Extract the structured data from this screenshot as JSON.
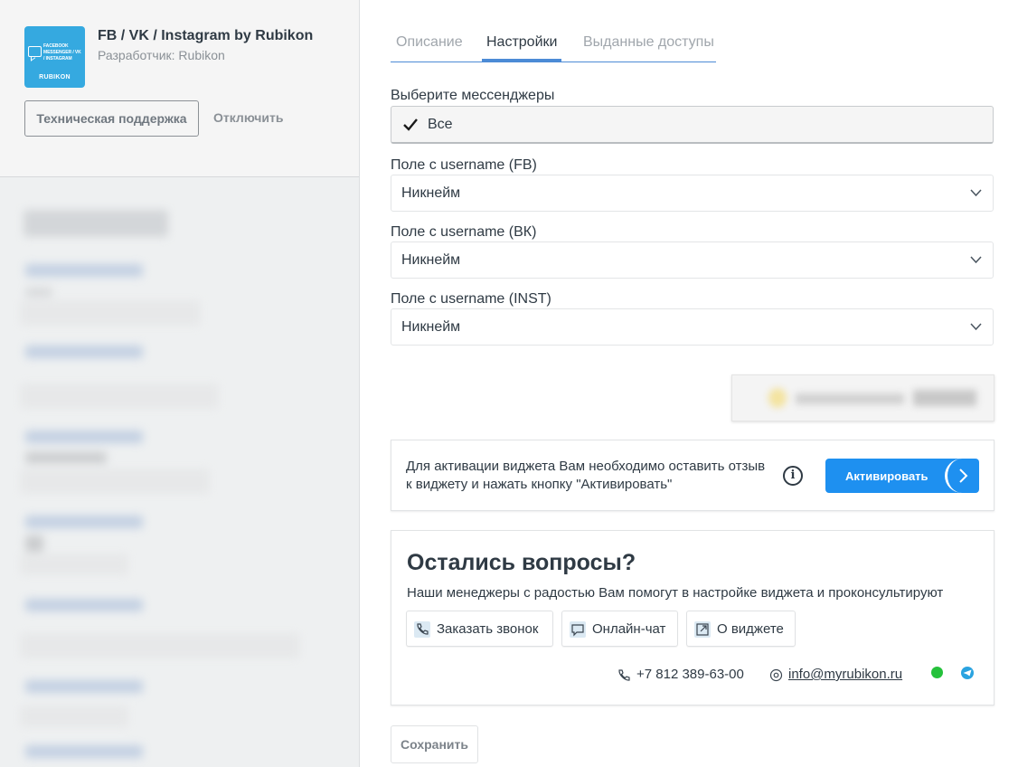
{
  "app": {
    "title": "FB / VK / Instagram by Rubikon",
    "developer": "Разработчик: Rubikon",
    "logo_text": "FACEBOOK MESSENGER / VK / INSTAGRAM",
    "logo_brand": "RUBIKON",
    "support_label": "Техническая поддержка",
    "disable_label": "Отключить"
  },
  "tabs": [
    {
      "label": "Описание",
      "active": false
    },
    {
      "label": "Настройки",
      "active": true
    },
    {
      "label": "Выданные доступы",
      "active": false
    }
  ],
  "settings": {
    "messengers_label": "Выберите мессенджеры",
    "messengers_all": "Все",
    "messengers_all_checked": true,
    "fields": [
      {
        "label": "Поле с username (FB)",
        "value": "Никнейм"
      },
      {
        "label": "Поле с username (ВК)",
        "value": "Никнейм"
      },
      {
        "label": "Поле с username (INST)",
        "value": "Никнейм"
      }
    ]
  },
  "activation": {
    "text": "Для активации виджета Вам необходимо оставить отзыв к виджету и нажать кнопку \"Активировать\"",
    "info_icon": "i",
    "button_label": "Активировать"
  },
  "questions": {
    "title": "Остались вопросы?",
    "subtitle": "Наши менеджеры с радостью Вам помогут в настройке виджета и проконсультируют",
    "buttons": [
      {
        "label": "Заказать звонок",
        "icon": "phone-icon"
      },
      {
        "label": "Онлайн-чат",
        "icon": "chat-icon"
      },
      {
        "label": "О виджете",
        "icon": "external-link-icon"
      }
    ],
    "phone": "+7 812 389-63-00",
    "email": "info@myrubikon.ru"
  },
  "save_label": "Сохранить",
  "colors": {
    "accent": "#4c8bd6",
    "activate_button": "#1e90f0",
    "logo_bg": "#35a9e0",
    "whatsapp": "#25c13b",
    "telegram": "#2aa3e0"
  }
}
